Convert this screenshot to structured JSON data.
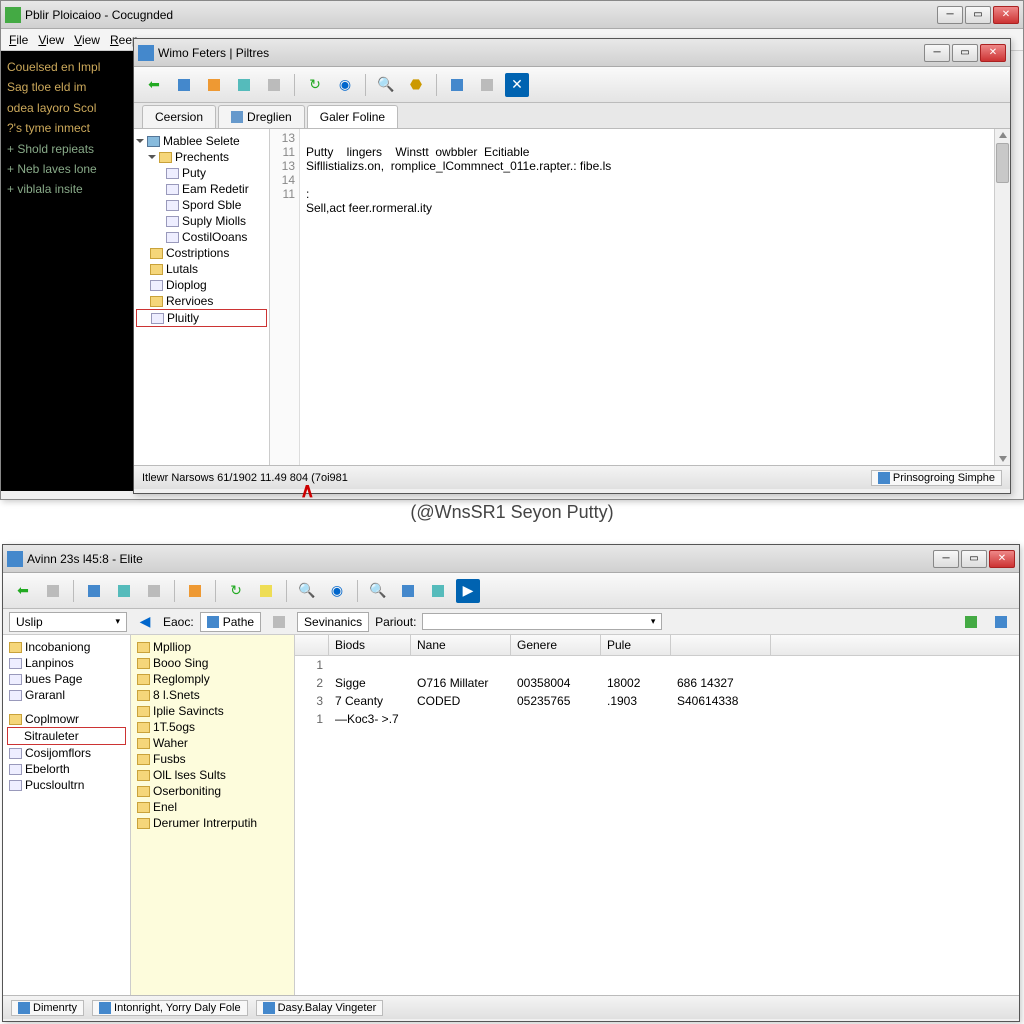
{
  "bgwin": {
    "title": "Pblir Ploicaioo - Cocugnded",
    "menu": [
      "File",
      "View",
      "View",
      "Reep"
    ],
    "console_lines": [
      "Couelsed en Impl",
      "",
      "Sag tloe eld im",
      "odea layoro Scol",
      "",
      "?'s tyme inmect",
      "",
      "+ Shold repieats",
      "",
      "+ Neb laves lone",
      "",
      "+ viblala insite"
    ]
  },
  "editor": {
    "title": "Wimo Feters | Piltres",
    "toolbar_icons": [
      "back",
      "fwd",
      "new",
      "open",
      "save",
      "refresh",
      "find",
      "stop",
      "zoom",
      "help",
      "layout",
      "grid",
      "close"
    ],
    "tabs": [
      {
        "label": "Ceersion",
        "active": false
      },
      {
        "label": "Dreglien",
        "active": false,
        "icon": true
      },
      {
        "label": "Galer Foline",
        "active": true
      }
    ],
    "tree": [
      {
        "depth": 0,
        "label": "Mablee Selete",
        "icon": "folder",
        "open": true
      },
      {
        "depth": 1,
        "label": "Prechents",
        "icon": "folder",
        "open": true
      },
      {
        "depth": 2,
        "label": "Puty",
        "icon": "file"
      },
      {
        "depth": 2,
        "label": "Eam Redetir",
        "icon": "file"
      },
      {
        "depth": 2,
        "label": "Spord Sble",
        "icon": "file"
      },
      {
        "depth": 2,
        "label": "Suply Miolls",
        "icon": "file"
      },
      {
        "depth": 2,
        "label": "CostilOoans",
        "icon": "file"
      },
      {
        "depth": 1,
        "label": "Costriptions",
        "icon": "folder"
      },
      {
        "depth": 1,
        "label": "Lutals",
        "icon": "folder"
      },
      {
        "depth": 1,
        "label": "Dioplog",
        "icon": "file"
      },
      {
        "depth": 1,
        "label": "Rervioes",
        "icon": "folder"
      },
      {
        "depth": 1,
        "label": "Pluitly",
        "icon": "file",
        "sel": true
      }
    ],
    "code": {
      "lines": [
        {
          "n": "13",
          "t": "Putty    lingers    Winstt  owbbler  Ecitiable"
        },
        {
          "n": "11",
          "t": "Sifllistializs.on,  romplice_lCommnect_011e.rapter.: fibe.ls"
        },
        {
          "n": "13",
          "t": ""
        },
        {
          "n": "14",
          "t": ":"
        },
        {
          "n": "11",
          "t": "Sell,act feer.rormeral.ity"
        }
      ]
    },
    "status_left": "Itlewr Narsows 61/1902 11.49  804  (7oi981",
    "status_right": "Prinsogroing Simphe"
  },
  "midcaption": "(@WnsSR1 Seyon Putty)",
  "browser": {
    "title": "Avinn 23s l45:8 - Elite",
    "toolbar_icons": [
      "back",
      "fwd",
      "up",
      "new",
      "copy",
      "paste",
      "refresh",
      "folder",
      "find",
      "stop",
      "zoom",
      "net",
      "pic",
      "go"
    ],
    "pathbar": {
      "left_label": "Uslip",
      "eaoc_label": "Eaoc:",
      "pathe_label": "Pathe",
      "sev_label": "Sevinanics",
      "pariout_label": "Pariout:"
    },
    "left_items": [
      {
        "label": "Incobaniong",
        "icon": "folder"
      },
      {
        "label": "Lanpinos",
        "icon": "file"
      },
      {
        "label": "bues Page",
        "icon": "file"
      },
      {
        "label": "Graranl",
        "icon": "file"
      },
      {
        "label": "",
        "spacer": true
      },
      {
        "label": "Coplmowr",
        "icon": "folder"
      },
      {
        "label": "Sitrauleter",
        "icon": "file",
        "sel": true
      },
      {
        "label": "Cosijomflors",
        "icon": "file"
      },
      {
        "label": "Ebelorth",
        "icon": "file"
      },
      {
        "label": "Pucsloultrn",
        "icon": "file"
      }
    ],
    "mid_items": [
      {
        "label": "Mplliop",
        "icon": "folder"
      },
      {
        "label": "Booo Sing",
        "icon": "folder"
      },
      {
        "label": "Reglomply",
        "icon": "folder"
      },
      {
        "label": "8 l.Snets",
        "icon": "folder"
      },
      {
        "label": "Iplie Savincts",
        "icon": "folder"
      },
      {
        "label": "1T.5ogs",
        "icon": "folder"
      },
      {
        "label": "Waher",
        "icon": "folder"
      },
      {
        "label": "Fusbs",
        "icon": "folder"
      },
      {
        "label": "OlL lses Sults",
        "icon": "folder"
      },
      {
        "label": "Oserboniting",
        "icon": "folder"
      },
      {
        "label": "Enel",
        "icon": "folder"
      },
      {
        "label": "Derumer Intrerputih",
        "icon": "folder"
      }
    ],
    "columns": [
      "Biods",
      "Nane",
      "Genere",
      "Pule",
      ""
    ],
    "rows": [
      {
        "n": "1",
        "cols": [
          "",
          "",
          "",
          "",
          ""
        ]
      },
      {
        "n": "2",
        "cols": [
          "Sigge",
          "O716 Millater",
          "00358004",
          "18002",
          "686 14327"
        ]
      },
      {
        "n": "3",
        "cols": [
          "7 Ceanty",
          "CODED",
          "05235765",
          ".1903",
          "S40614338"
        ]
      },
      {
        "n": "1",
        "cols": [
          "—Koc3- >.7",
          "",
          "",
          "",
          ""
        ]
      }
    ],
    "status_segments": [
      "Dimenrty",
      "Intonright, Yorry Daly Fole",
      "Dasy.Balay Vingeter"
    ]
  }
}
